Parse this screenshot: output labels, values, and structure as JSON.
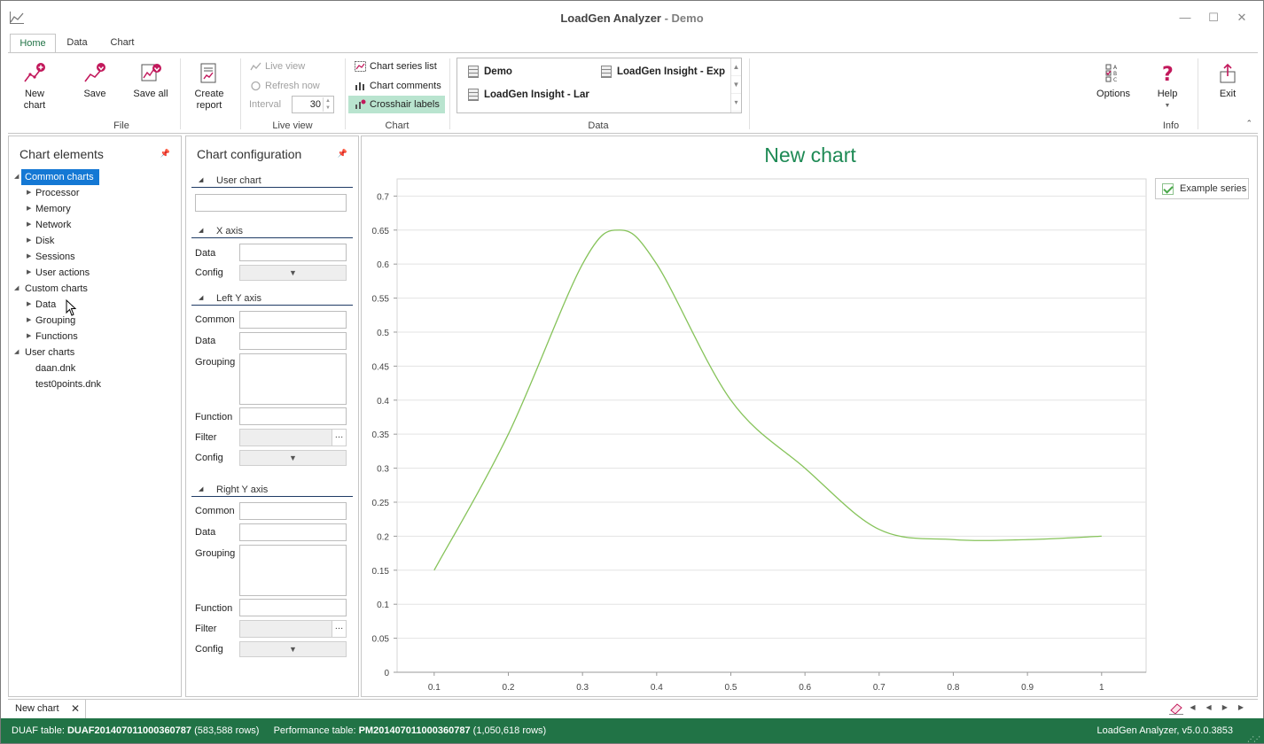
{
  "window": {
    "title": "LoadGen Analyzer",
    "title_separator": " - ",
    "title_sub": "Demo",
    "minimize": "—",
    "maximize": "☐",
    "close": "✕"
  },
  "tabs": [
    "Home",
    "Data",
    "Chart"
  ],
  "ribbon": {
    "file": {
      "label": "File",
      "new_chart": [
        "New",
        "chart"
      ],
      "save": "Save",
      "save_all": "Save all",
      "create_report": [
        "Create",
        "report"
      ]
    },
    "live_view": {
      "label": "Live view",
      "live_view_btn": "Live view",
      "refresh_now": "Refresh now",
      "interval_label": "Interval",
      "interval_value": "30"
    },
    "chart": {
      "label": "Chart",
      "series_list": "Chart series list",
      "comments": "Chart comments",
      "crosshair": "Crosshair labels"
    },
    "data": {
      "label": "Data",
      "items": [
        "Demo",
        "LoadGen Insight - Exp",
        "LoadGen Insight - Lar"
      ]
    },
    "info": {
      "label": "Info",
      "options": "Options",
      "help": "Help",
      "exit": "Exit"
    }
  },
  "chart_elements": {
    "title": "Chart elements",
    "common_charts": "Common charts",
    "common_children": [
      "Processor",
      "Memory",
      "Network",
      "Disk",
      "Sessions",
      "User actions"
    ],
    "custom_charts": "Custom charts",
    "custom_children": [
      "Data",
      "Grouping",
      "Functions"
    ],
    "user_charts": "User charts",
    "user_children": [
      "daan.dnk",
      "test0points.dnk"
    ]
  },
  "chart_config": {
    "title": "Chart configuration",
    "user_chart": "User chart",
    "x_axis": {
      "title": "X axis",
      "data": "Data",
      "config": "Config"
    },
    "left_y": {
      "title": "Left Y axis",
      "common": "Common",
      "data": "Data",
      "grouping": "Grouping",
      "function": "Function",
      "filter": "Filter",
      "config": "Config"
    },
    "right_y": {
      "title": "Right Y axis",
      "common": "Common",
      "data": "Data",
      "grouping": "Grouping",
      "function": "Function",
      "filter": "Filter",
      "config": "Config"
    }
  },
  "chart_data": {
    "type": "line",
    "title": "New chart",
    "xlabel": "",
    "ylabel": "",
    "xlim": [
      0.05,
      1.06
    ],
    "ylim": [
      0,
      0.72
    ],
    "x_ticks": [
      0.1,
      0.2,
      0.3,
      0.4,
      0.5,
      0.6,
      0.7,
      0.8,
      0.9,
      1
    ],
    "y_ticks": [
      0,
      0.05,
      0.1,
      0.15,
      0.2,
      0.25,
      0.3,
      0.35,
      0.4,
      0.45,
      0.5,
      0.55,
      0.6,
      0.65,
      0.7
    ],
    "grid": true,
    "legend": "top-right",
    "series": [
      {
        "name": "Example series",
        "color": "#86c35a",
        "x": [
          0.1,
          0.2,
          0.3,
          0.35,
          0.4,
          0.5,
          0.6,
          0.7,
          0.8,
          0.9,
          1
        ],
        "y": [
          0.15,
          0.35,
          0.6,
          0.65,
          0.6,
          0.4,
          0.3,
          0.21,
          0.195,
          0.195,
          0.2
        ]
      }
    ]
  },
  "doc_tab": {
    "label": "New chart",
    "close": "✕"
  },
  "status": {
    "duaf_label": "DUAF table: ",
    "duaf_name": "DUAF201407011000360787",
    "duaf_rows": " (583,588 rows)",
    "perf_label": "Performance table: ",
    "perf_name": "PM201407011000360787",
    "perf_rows": " (1,050,618 rows)",
    "version": "LoadGen Analyzer, v5.0.0.3853"
  },
  "colors": {
    "accent": "#217346",
    "selection": "#1478d4",
    "series": "#86c35a",
    "title": "#1e8a55"
  }
}
